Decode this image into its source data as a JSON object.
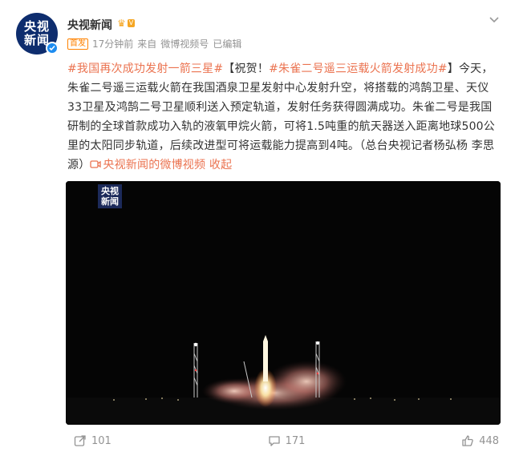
{
  "author": {
    "name": "央视新闻",
    "avatar_line1": "央视",
    "avatar_line2": "新闻",
    "vip_badge": "V"
  },
  "meta": {
    "first_badge": "首发",
    "time": "17分钟前",
    "source_prefix": "来自",
    "source": "微博视频号",
    "edited": "已编辑"
  },
  "post": {
    "tag1": "#我国再次成功发射一箭三星#",
    "text1": "【祝贺！",
    "tag2": "#朱雀二号遥三运载火箭发射成功#",
    "text2": "】今天，朱雀二号遥三运载火箭在我国酒泉卫星发射中心发射升空，将搭载的鸿鹄卫星、天仪33卫星及鸿鹄二号卫星顺利送入预定轨道，发射任务获得圆满成功。朱雀二号是我国研制的全球首款成功入轨的液氧甲烷火箭，可将1.5吨重的航天器送入距离地球500公里的太阳同步轨道，后续改进型可将运载能力提高到4吨。（总台央视记者杨弘杨 李思源）",
    "video_link": "央视新闻的微博视频",
    "collapse": "收起"
  },
  "video": {
    "watermark_line1": "央视",
    "watermark_line2": "新闻"
  },
  "actions": {
    "share_count": "101",
    "comment_count": "171",
    "like_count": "448"
  },
  "colors": {
    "link": "#eb7350",
    "meta": "#939393",
    "brand_blue": "#0e2d6e"
  }
}
